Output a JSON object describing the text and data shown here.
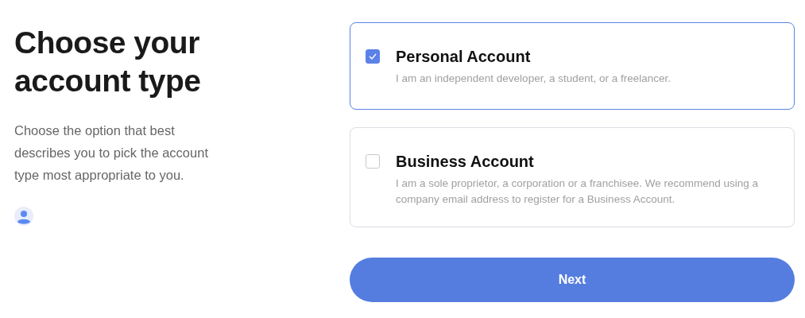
{
  "heading": "Choose your account type",
  "description": "Choose the option that best describes you to pick the account type most appropriate to you.",
  "options": [
    {
      "title": "Personal Account",
      "description": "I am an independent developer, a student, or a freelancer.",
      "selected": true
    },
    {
      "title": "Business Account",
      "description": "I am a sole proprietor, a corporation or a franchisee. We recommend using a company email address to register for a Business Account.",
      "selected": false
    }
  ],
  "next_button": "Next"
}
